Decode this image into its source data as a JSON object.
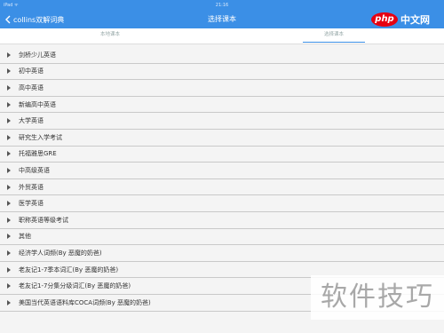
{
  "status": {
    "left": "iPad ᯤ",
    "time": "21:16"
  },
  "nav": {
    "back_label": "collins双解词典",
    "title": "选择课本"
  },
  "brand": {
    "php": "php",
    "cn": "中文网"
  },
  "tabs": [
    {
      "label": "本地课本"
    },
    {
      "label": "选择课本"
    }
  ],
  "list": [
    "剑桥少儿英语",
    "初中英语",
    "高中英语",
    "新编高中英语",
    "大学英语",
    "研究生入学考试",
    "托福雅思GRE",
    "中高级英语",
    "外贸英语",
    "医学英语",
    "职称英语等级考试",
    "其他",
    "经济学人词频(By 恶魔的奶爸)",
    "老友记1-7季本词汇(By 恶魔的奶爸)",
    "老友记1-7分集分级词汇(By 恶魔的奶爸)",
    "美国当代英语语料库COCA词频(By 恶魔的奶爸)"
  ],
  "watermark": "软件技巧"
}
